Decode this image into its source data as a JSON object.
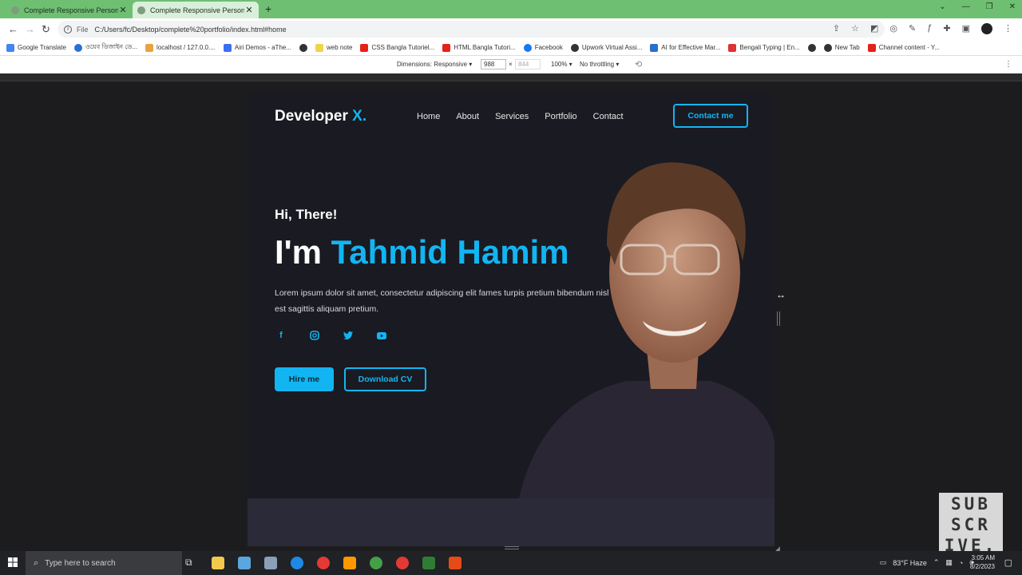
{
  "browser": {
    "tabs": [
      {
        "title": "Complete Responsive Personal P",
        "active": false
      },
      {
        "title": "Complete Responsive Personal P",
        "active": true
      }
    ],
    "url_scheme_label": "File",
    "url": "C:/Users/fc/Desktop/complete%20portfolio/index.html#home",
    "bookmarks": [
      "Google Translate",
      "ওয়েব ডিজাইন ডে...",
      "localhost / 127.0.0....",
      "Airi Demos - aThe...",
      "web note",
      "CSS Bangla Tutoriel...",
      "HTML Bangla Tutori...",
      "Facebook",
      "Upwork Virtual Assi...",
      "AI for Effective Mar...",
      "Bengali Typing | En...",
      "New Tab",
      "Channel content - Y..."
    ]
  },
  "devtools": {
    "dimensions_label": "Dimensions: Responsive ▾",
    "width": "988",
    "x": "×",
    "height": "844",
    "zoom": "100% ▾",
    "throttling": "No throttling ▾"
  },
  "site": {
    "logo_text": "Developer ",
    "logo_accent": "X.",
    "nav": [
      "Home",
      "About",
      "Services",
      "Portfolio",
      "Contact"
    ],
    "contact_button": "Contact me",
    "greeting": "Hi, There!",
    "headline_prefix": "I'm ",
    "headline_name": "Tahmid Hamim",
    "description": "Lorem ipsum dolor sit amet, consectetur adipiscing elit fames turpis pretium bibendum nisl est sagittis aliquam pretium.",
    "socials": [
      "facebook-icon",
      "instagram-icon",
      "twitter-icon",
      "youtube-icon"
    ],
    "hire_button": "Hire me",
    "cv_button": "Download CV",
    "accent_color": "#12b5f2"
  },
  "overlay": {
    "subscribe_lines": [
      "SUB",
      "SCR",
      "IVE."
    ]
  },
  "taskbar": {
    "search_placeholder": "Type here to search",
    "weather": "83°F  Haze",
    "time": "3:05 AM",
    "date": "8/2/2023"
  }
}
